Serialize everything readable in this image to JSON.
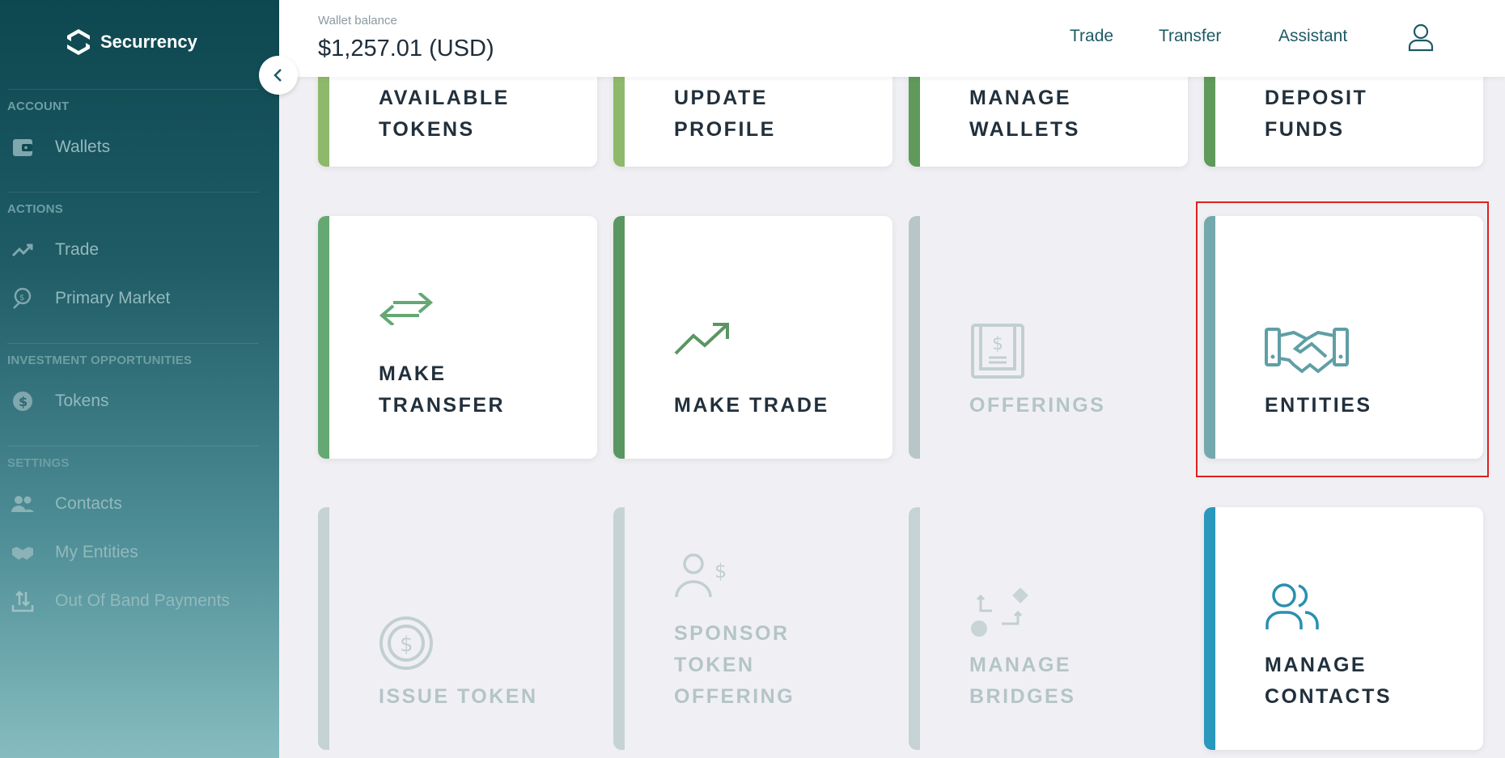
{
  "sidebar": {
    "brand": "Securrency",
    "sections": [
      {
        "label": "ACCOUNT"
      },
      {
        "label": "ACTIONS"
      },
      {
        "label": "INVESTMENT OPPORTUNITIES"
      },
      {
        "label": "SETTINGS"
      }
    ],
    "items": [
      {
        "label": "Wallets",
        "icon": "wallet-icon"
      },
      {
        "label": "Trade",
        "icon": "trend-icon"
      },
      {
        "label": "Primary Market",
        "icon": "primary-market-icon"
      },
      {
        "label": "Tokens",
        "icon": "dollar-coin-icon"
      },
      {
        "label": "Contacts",
        "icon": "contacts-icon"
      },
      {
        "label": "My Entities",
        "icon": "handshake-icon"
      },
      {
        "label": "Out Of Band Payments",
        "icon": "transfer-tray-icon"
      }
    ]
  },
  "header": {
    "wallet_balance_label": "Wallet balance",
    "wallet_balance_value": "$1,257.01 (USD)",
    "links": [
      "Trade",
      "Transfer",
      "Assistant"
    ]
  },
  "cards": [
    {
      "title": "AVAILABLE\nTOKENS",
      "bar_color": "#8fb96a",
      "state": "enabled"
    },
    {
      "title": "UPDATE\nPROFILE",
      "bar_color": "#8fb96a",
      "state": "enabled"
    },
    {
      "title": "MANAGE\nWALLETS",
      "bar_color": "#5f9a5a",
      "state": "enabled"
    },
    {
      "title": "DEPOSIT\nFUNDS",
      "bar_color": "#5f9a5a",
      "state": "enabled"
    },
    {
      "title": "MAKE\nTRANSFER",
      "bar_color": "#65a874",
      "state": "enabled",
      "icon": "arrows-left-right-icon"
    },
    {
      "title": "MAKE TRADE",
      "bar_color": "#5a9662",
      "state": "enabled",
      "icon": "trend-up-icon"
    },
    {
      "title": "OFFERINGS",
      "bar_color": "#b8c6c8",
      "state": "disabled",
      "icon": "document-dollar-icon"
    },
    {
      "title": "ENTITIES",
      "bar_color": "#73a9ad",
      "state": "enabled",
      "icon": "handshake-icon"
    },
    {
      "title": "ISSUE TOKEN",
      "bar_color": "#c6d3d5",
      "state": "disabled",
      "icon": "coin-icon"
    },
    {
      "title": "SPONSOR\nTOKEN\nOFFERING",
      "bar_color": "#c6d3d5",
      "state": "disabled",
      "icon": "sponsor-icon"
    },
    {
      "title": "MANAGE\nBRIDGES",
      "bar_color": "#c6d3d5",
      "state": "disabled",
      "icon": "bridge-icon"
    },
    {
      "title": "MANAGE\nCONTACTS",
      "bar_color": "#2a97bd",
      "state": "enabled",
      "icon": "users-icon"
    }
  ]
}
